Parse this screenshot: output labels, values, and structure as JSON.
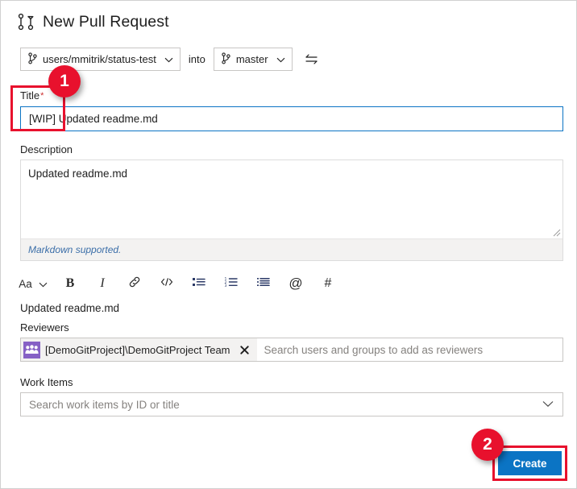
{
  "header": {
    "icon": "pull-request-icon",
    "title": "New Pull Request"
  },
  "branch_row": {
    "source_branch": "users/mmitrik/status-test",
    "into_label": "into",
    "target_branch": "master",
    "swap_icon": "swap-branches-icon",
    "branch_icon": "git-branch-icon",
    "chevron_icon": "chevron-down-icon"
  },
  "title_field": {
    "label": "Title",
    "required_marker": "*",
    "value": "[WIP] Updated readme.md"
  },
  "description_field": {
    "label": "Description",
    "value": "Updated readme.md",
    "markdown_note": "Markdown supported."
  },
  "format_toolbar": {
    "items": [
      {
        "name": "font-size-button",
        "label": "Aa"
      },
      {
        "name": "bold-button",
        "label": "B"
      },
      {
        "name": "italic-button",
        "label": "I"
      },
      {
        "name": "link-button",
        "label": "link-icon"
      },
      {
        "name": "code-button",
        "label": "code-icon"
      },
      {
        "name": "bulleted-list-button",
        "label": "bulleted-list-icon"
      },
      {
        "name": "numbered-list-button",
        "label": "numbered-list-icon"
      },
      {
        "name": "task-list-button",
        "label": "task-list-icon"
      },
      {
        "name": "mention-button",
        "label": "@"
      },
      {
        "name": "hashtag-button",
        "label": "#"
      }
    ]
  },
  "preview": {
    "text": "Updated readme.md"
  },
  "reviewers_field": {
    "label": "Reviewers",
    "chip": {
      "avatar_icon": "team-avatar-icon",
      "label": "[DemoGitProject]\\DemoGitProject Team",
      "remove_icon": "close-icon"
    },
    "placeholder": "Search users and groups to add as reviewers"
  },
  "work_items_field": {
    "label": "Work Items",
    "placeholder": "Search work items by ID or title",
    "chevron_icon": "chevron-down-icon"
  },
  "actions": {
    "create_label": "Create"
  },
  "annotations": {
    "badge_1": "1",
    "badge_2": "2"
  },
  "colors": {
    "accent_blue": "#0b74c4",
    "annotation_red": "#e8112d",
    "team_purple": "#8661c5",
    "markdown_link": "#3b6ea8"
  }
}
